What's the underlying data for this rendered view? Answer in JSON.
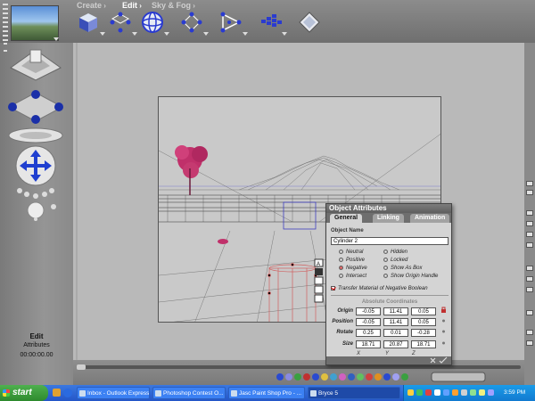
{
  "menus": {
    "create": "Create",
    "edit": "Edit",
    "sky_fog": "Sky & Fog"
  },
  "left_panel": {
    "title": "Edit",
    "subtitle": "Attributes",
    "timecode": "00:00:00.00"
  },
  "dialog": {
    "title": "Object Attributes",
    "tabs": [
      "General",
      "Linking",
      "Animation"
    ],
    "object_name_label": "Object Name",
    "object_name": "Cylinder 2",
    "radios_left": [
      "Neutral",
      "Positive",
      "Negative",
      "Intersect"
    ],
    "radios_right": [
      "Hidden",
      "Locked",
      "Show As Box",
      "Show Origin Handle"
    ],
    "selected_radio": "Negative",
    "checkbox_label": "Transfer Material of Negative Boolean",
    "coords_heading": "Absolute Coordinates",
    "rows": [
      {
        "label": "Origin",
        "values": [
          "-0.05",
          "11.41",
          "0.05"
        ]
      },
      {
        "label": "Position",
        "values": [
          "-0.05",
          "11.41",
          "0.05"
        ]
      },
      {
        "label": "Rotate",
        "values": [
          "0.25",
          "0.01",
          "-0.28"
        ]
      },
      {
        "label": "Size",
        "values": [
          "18.71",
          "20.87",
          "18.71"
        ]
      }
    ],
    "axes": [
      "X",
      "Y",
      "Z"
    ]
  },
  "taskbar": {
    "start": "start",
    "tasks": [
      "Inbox - Outlook Express",
      "Photoshop Contest O...",
      "Jasc Paint Shop Pro - ...",
      "Bryce 5"
    ],
    "clock": "3:59 PM"
  },
  "colors": {
    "tree": "#c0306a",
    "selection": "#4040c0",
    "cylinder": "#d06060"
  }
}
